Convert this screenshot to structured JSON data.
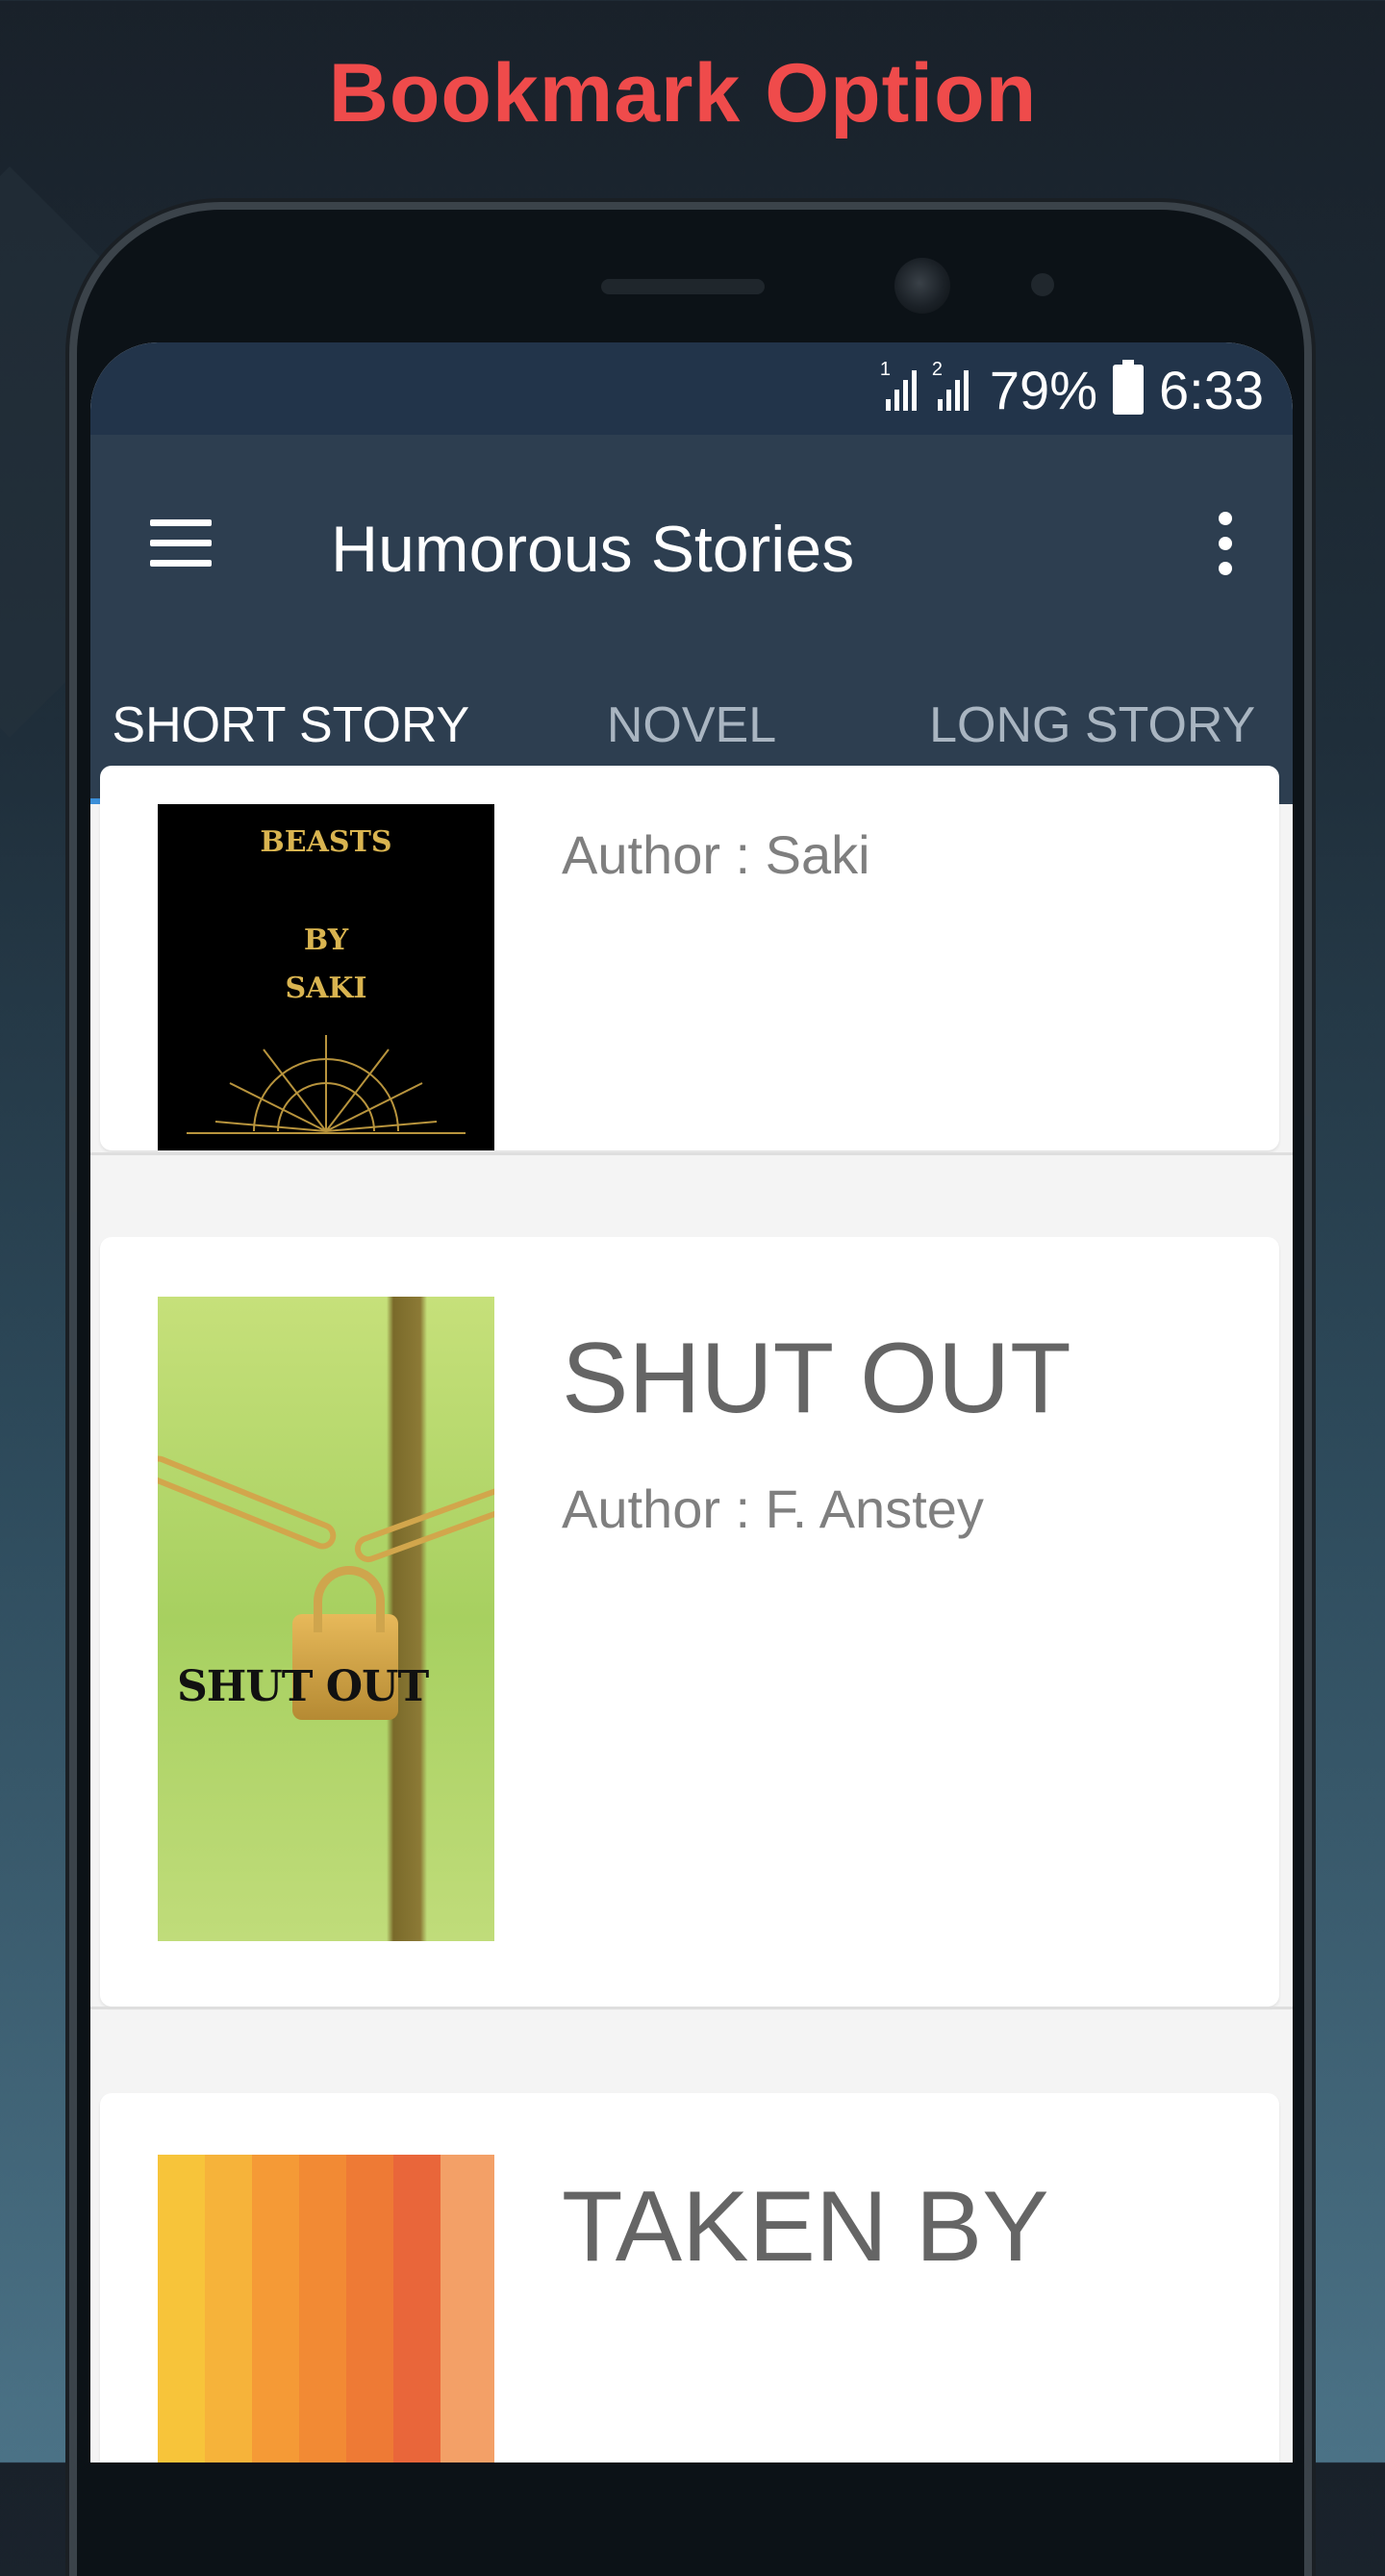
{
  "promo": {
    "title": "Bookmark Option"
  },
  "status_bar": {
    "sim1_label": "1",
    "sim2_label": "2",
    "battery_percent": "79%",
    "time": "6:33"
  },
  "app_bar": {
    "title": "Humorous Stories"
  },
  "tabs": [
    {
      "label": "SHORT STORY",
      "active": true
    },
    {
      "label": "NOVEL",
      "active": false
    },
    {
      "label": "LONG STORY",
      "active": false
    }
  ],
  "stories": [
    {
      "title": "",
      "author": "Author : Saki",
      "cover_text": [
        "BEASTS",
        "BY",
        "SAKI"
      ]
    },
    {
      "title": "SHUT OUT",
      "author": "Author : F. Anstey",
      "cover_text": "SHUT OUT"
    },
    {
      "title": "TAKEN BY",
      "author": ""
    }
  ],
  "colors": {
    "promo_title": "#ef4b4b",
    "app_bar": "#2d3e50",
    "status_bar": "#22344a",
    "tab_indicator": "#3b8fd8"
  }
}
